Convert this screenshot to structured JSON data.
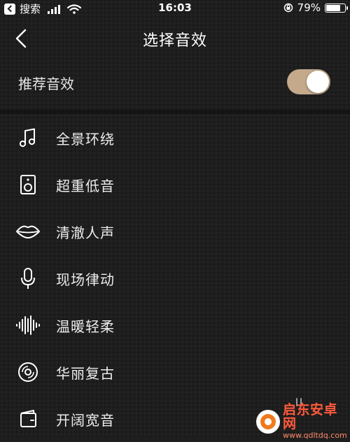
{
  "status_bar": {
    "carrier": "搜索",
    "time": "16:03",
    "battery_percent": "79%",
    "battery_level": 0.79
  },
  "nav": {
    "title": "选择音效"
  },
  "recommend": {
    "label": "推荐音效",
    "enabled": true
  },
  "effects": [
    {
      "label": "全景环绕",
      "icon": "music-note-icon"
    },
    {
      "label": "超重低音",
      "icon": "speaker-icon"
    },
    {
      "label": "清澈人声",
      "icon": "lips-icon"
    },
    {
      "label": "现场律动",
      "icon": "microphone-icon"
    },
    {
      "label": "温暖轻柔",
      "icon": "waveform-icon"
    },
    {
      "label": "华丽复古",
      "icon": "vinyl-disc-icon"
    },
    {
      "label": "开阔宽音",
      "icon": "wallet-icon"
    }
  ],
  "watermark": {
    "title": "启东安卓网",
    "url": "www.qdltdq.com"
  },
  "colors": {
    "background": "#1e1e1e",
    "toggle_on": "#c4a98b",
    "watermark_orange": "#f07a1c",
    "watermark_text": "#ff5a3c"
  }
}
